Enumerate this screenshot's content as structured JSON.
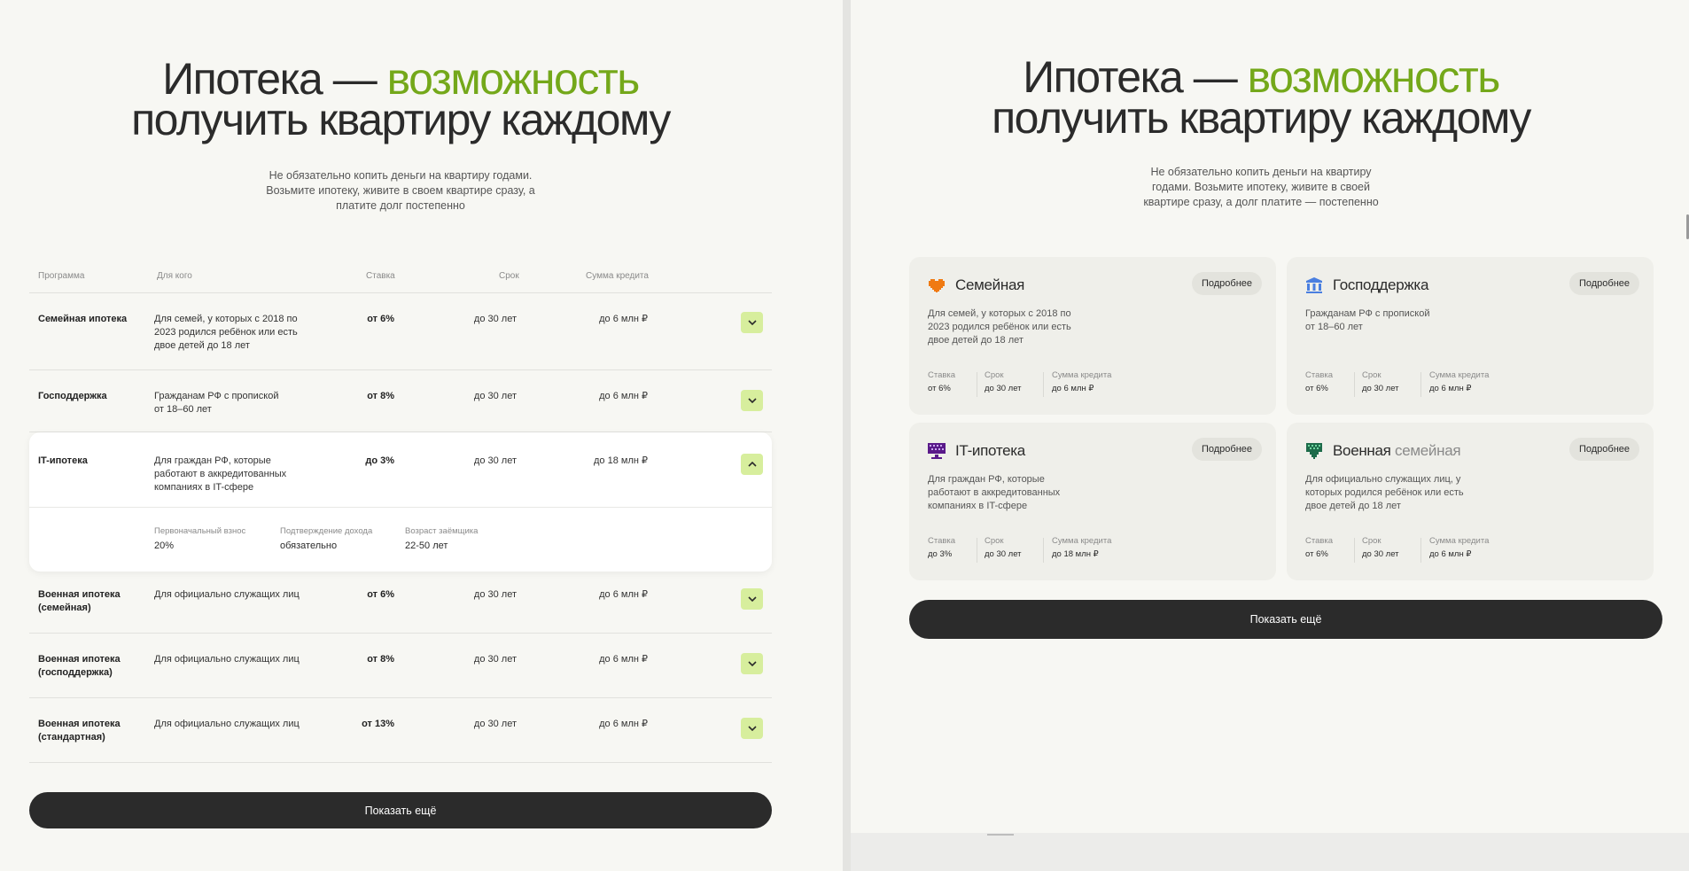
{
  "left": {
    "title": {
      "line1": "Ипотека — ",
      "accent": "возможность",
      "line2": "получить квартиру каждому"
    },
    "lead": "Не обязательно копить деньги на квартиру годами. Возьмите ипотеку, живите в своем квартире сразу, а платите долг постепенно",
    "table": {
      "headers": {
        "program": "Программа",
        "who": "Для кого",
        "rate": "Ставка",
        "term": "Срок",
        "sum": "Сумма кредита"
      },
      "rows": [
        {
          "program": "Семейная ипотека",
          "who": "Для семей, у которых с 2018 по 2023 родился ребёнок или есть двое детей до 18 лет",
          "rate": "от 6%",
          "term": "до 30 лет",
          "sum": "до 6 млн ₽"
        },
        {
          "program": "Господдержка",
          "who": "Гражданам РФ с пропиской от 18–60 лет",
          "rate": "от 8%",
          "term": "до 30 лет",
          "sum": "до 6 млн ₽"
        },
        {
          "program": "IT-ипотека",
          "who": "Для граждан РФ, которые работают в аккредитованных компаниях в IT-сфере",
          "rate": "до 3%",
          "term": "до 30 лет",
          "sum": "до 18 млн ₽",
          "details": [
            {
              "label": "Первоначальный взнос",
              "value": "20%"
            },
            {
              "label": "Подтверждение дохода",
              "value": "обязательно"
            },
            {
              "label": "Возраст заёмщика",
              "value": "22-50 лет"
            }
          ]
        },
        {
          "program": "Военная ипотека (семейная)",
          "who": "Для официально служащих лиц",
          "rate": "от 6%",
          "term": "до 30 лет",
          "sum": "до 6 млн ₽"
        },
        {
          "program": "Военная ипотека (господдержка)",
          "who": "Для официально служащих лиц",
          "rate": "от 8%",
          "term": "до 30 лет",
          "sum": "до 6 млн ₽"
        },
        {
          "program": "Военная ипотека (стандартная)",
          "who": "Для официально служащих лиц",
          "rate": "от 13%",
          "term": "до 30 лет",
          "sum": "до 6 млн ₽"
        }
      ]
    },
    "show_more": "Показать ещё"
  },
  "right": {
    "title": {
      "line1": "Ипотека — ",
      "accent": "возможность",
      "line2": "получить квартиру каждому"
    },
    "lead": "Не обязательно копить деньги на квартиру годами. Возьмите ипотеку, живите в своей квартире сразу, а долг платите — постепенно",
    "metric_labels": {
      "rate": "Ставка",
      "term": "Срок",
      "sum": "Сумма кредита"
    },
    "cards": [
      {
        "icon": "heart-icon",
        "title": "Семейная",
        "title_muted": "",
        "more": "Подробнее",
        "desc": "Для семей, у которых с 2018 по 2023 родился ребёнок или есть двое детей до 18 лет",
        "rate": "от 6%",
        "term": "до 30 лет",
        "sum": "до 6 млн ₽"
      },
      {
        "icon": "government-building-icon",
        "title": "Господдержка",
        "title_muted": "",
        "more": "Подробнее",
        "desc": "Гражданам РФ с пропиской от 18–60 лет",
        "rate": "от 6%",
        "term": "до 30 лет",
        "sum": "до 6 млн ₽"
      },
      {
        "icon": "computer-monitor-icon",
        "title": "IT-ипотека",
        "title_muted": "",
        "more": "Подробнее",
        "desc": "Для граждан РФ, которые работают в аккредитованных компаниях в IT-сфере",
        "rate": "до 3%",
        "term": "до 30 лет",
        "sum": "до 18 млн ₽"
      },
      {
        "icon": "military-badge-icon",
        "title": "Военная ",
        "title_muted": "семейная",
        "more": "Подробнее",
        "desc": "Для официально служащих лиц, у которых родился ребёнок или есть двое детей до 18 лет",
        "rate": "от 6%",
        "term": "до 30 лет",
        "sum": "до 6 млн ₽"
      }
    ],
    "show_more": "Показать ещё"
  },
  "colors": {
    "accent": "#74a81a",
    "chevron_bg": "#d7ee9d",
    "dark_button": "#2b2b2b",
    "heart": "#f07a12",
    "government": "#4a7fe0",
    "it": "#5a1a8a",
    "military": "#1d6b4a"
  }
}
